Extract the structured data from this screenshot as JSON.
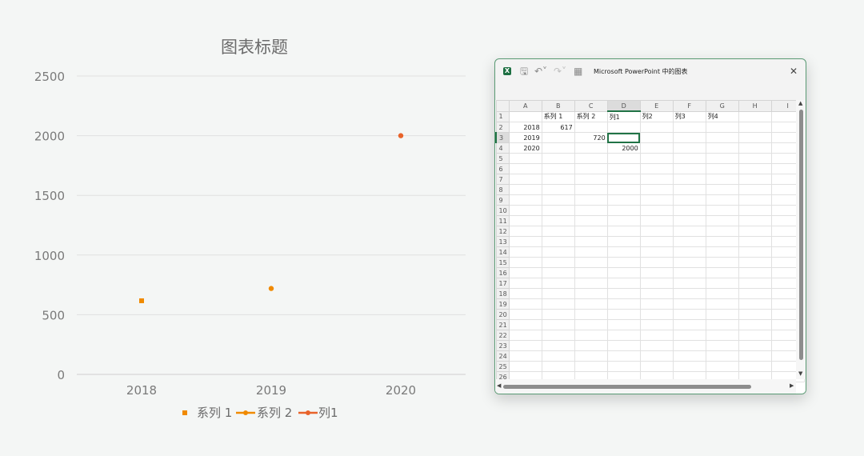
{
  "chart_data": {
    "type": "scatter",
    "title": "图表标题",
    "categories": [
      "2018",
      "2019",
      "2020"
    ],
    "ylim": [
      0,
      2500
    ],
    "yticks": [
      0,
      500,
      1000,
      1500,
      2000,
      2500
    ],
    "grid": true,
    "legend_position": "bottom",
    "series": [
      {
        "name": "系列 1",
        "values": [
          617,
          null,
          null
        ],
        "color": "#f08a00",
        "marker": "square"
      },
      {
        "name": "系列 2",
        "values": [
          null,
          720,
          null
        ],
        "color": "#f08a00",
        "marker": "circle"
      },
      {
        "name": "列1",
        "values": [
          null,
          null,
          2000
        ],
        "color": "#e8632a",
        "marker": "circle"
      }
    ]
  },
  "excel": {
    "title": "Microsoft PowerPoint 中的图表",
    "icons": [
      "excel-logo-icon",
      "save-icon",
      "undo-icon",
      "redo-icon",
      "edit-data-icon",
      "close-icon"
    ],
    "accent_color": "#217346",
    "columns": [
      "A",
      "B",
      "C",
      "D",
      "E",
      "F",
      "G",
      "H",
      "I"
    ],
    "selected_cell": "D3",
    "rows": [
      [
        "",
        "系列 1",
        "系列 2",
        "列1",
        "列2",
        "列3",
        "列4",
        "",
        ""
      ],
      [
        "2018",
        "617",
        "",
        "",
        "",
        "",
        "",
        "",
        ""
      ],
      [
        "2019",
        "",
        "720",
        "",
        "",
        "",
        "",
        "",
        ""
      ],
      [
        "2020",
        "",
        "",
        "2000",
        "",
        "",
        "",
        "",
        ""
      ]
    ],
    "row_count": 26
  }
}
